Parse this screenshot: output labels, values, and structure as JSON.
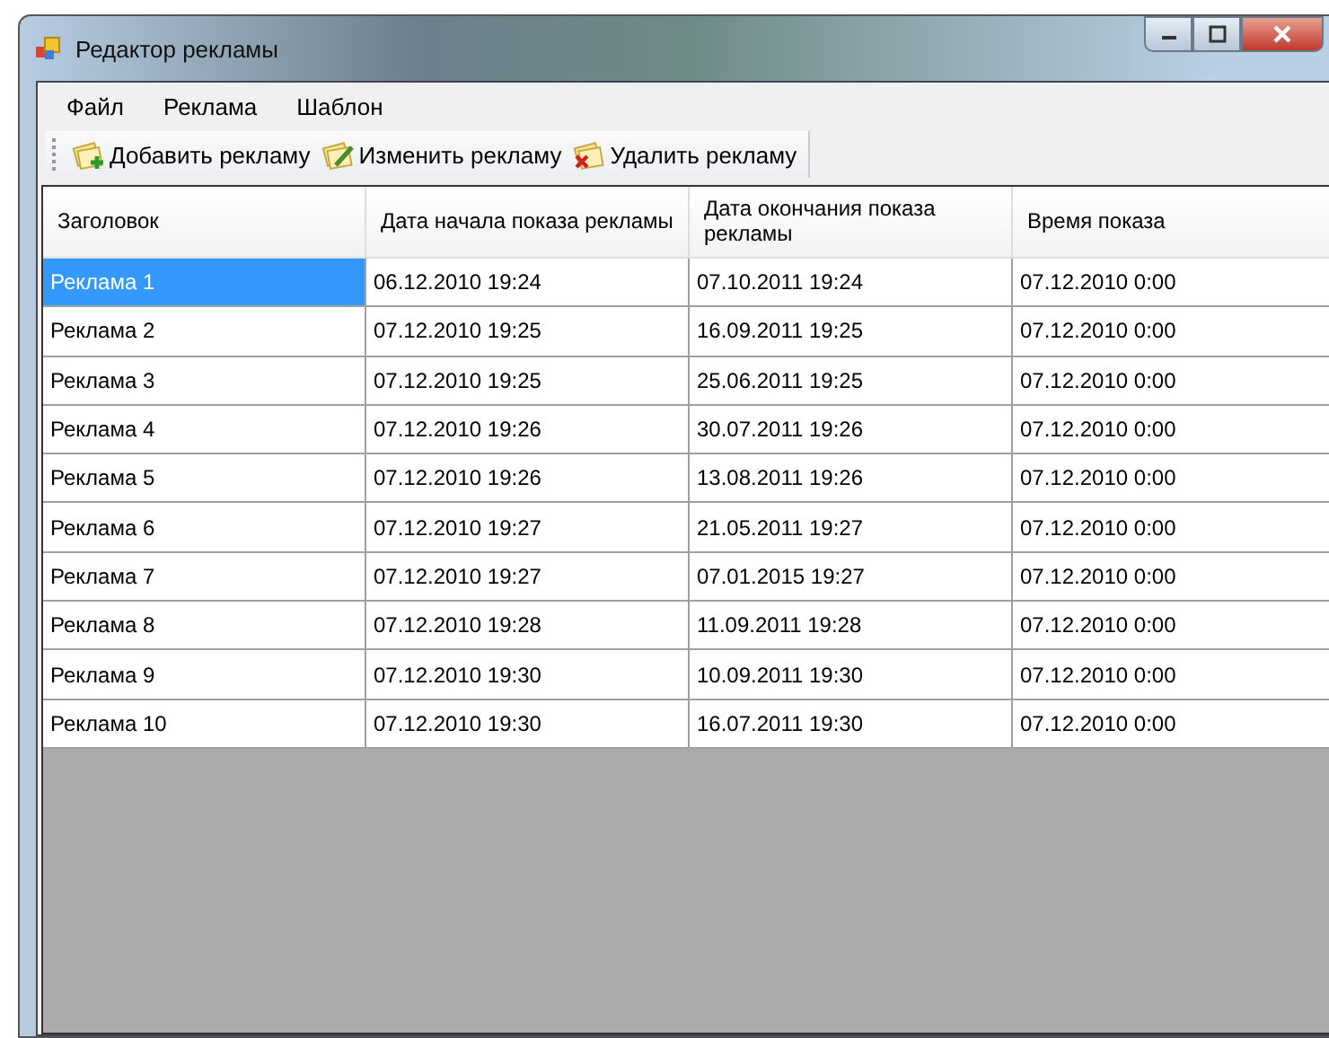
{
  "window": {
    "title": "Редактор рекламы"
  },
  "menu": [
    "Файл",
    "Реклама",
    "Шаблон"
  ],
  "toolbar": [
    {
      "label": "Добавить рекламу",
      "kind": "add"
    },
    {
      "label": "Изменить рекламу",
      "kind": "edit"
    },
    {
      "label": "Удалить рекламу",
      "kind": "delete"
    }
  ],
  "table": {
    "columns": [
      "Заголовок",
      "Дата начала показа рекламы",
      "Дата окончания показа рекламы",
      "Время показа"
    ],
    "rows": [
      {
        "cells": [
          "Реклама 1",
          "06.12.2010 19:24",
          "07.10.2011 19:24",
          "07.12.2010 0:00"
        ],
        "selected": true
      },
      {
        "cells": [
          "Реклама 2",
          "07.12.2010 19:25",
          "16.09.2011 19:25",
          "07.12.2010 0:00"
        ],
        "selected": false
      },
      {
        "cells": [
          "Реклама 3",
          "07.12.2010 19:25",
          "25.06.2011 19:25",
          "07.12.2010 0:00"
        ],
        "selected": false
      },
      {
        "cells": [
          "Реклама 4",
          "07.12.2010 19:26",
          "30.07.2011 19:26",
          "07.12.2010 0:00"
        ],
        "selected": false
      },
      {
        "cells": [
          "Реклама 5",
          "07.12.2010 19:26",
          "13.08.2011 19:26",
          "07.12.2010 0:00"
        ],
        "selected": false
      },
      {
        "cells": [
          "Реклама 6",
          "07.12.2010 19:27",
          "21.05.2011 19:27",
          "07.12.2010 0:00"
        ],
        "selected": false
      },
      {
        "cells": [
          "Реклама 7",
          "07.12.2010 19:27",
          "07.01.2015 19:27",
          "07.12.2010 0:00"
        ],
        "selected": false
      },
      {
        "cells": [
          "Реклама 8",
          "07.12.2010 19:28",
          "11.09.2011 19:28",
          "07.12.2010 0:00"
        ],
        "selected": false
      },
      {
        "cells": [
          "Реклама 9",
          "07.12.2010 19:30",
          "10.09.2011 19:30",
          "07.12.2010 0:00"
        ],
        "selected": false
      },
      {
        "cells": [
          "Реклама 10",
          "07.12.2010 19:30",
          "16.07.2011 19:30",
          "07.12.2010 0:00"
        ],
        "selected": false
      }
    ]
  }
}
